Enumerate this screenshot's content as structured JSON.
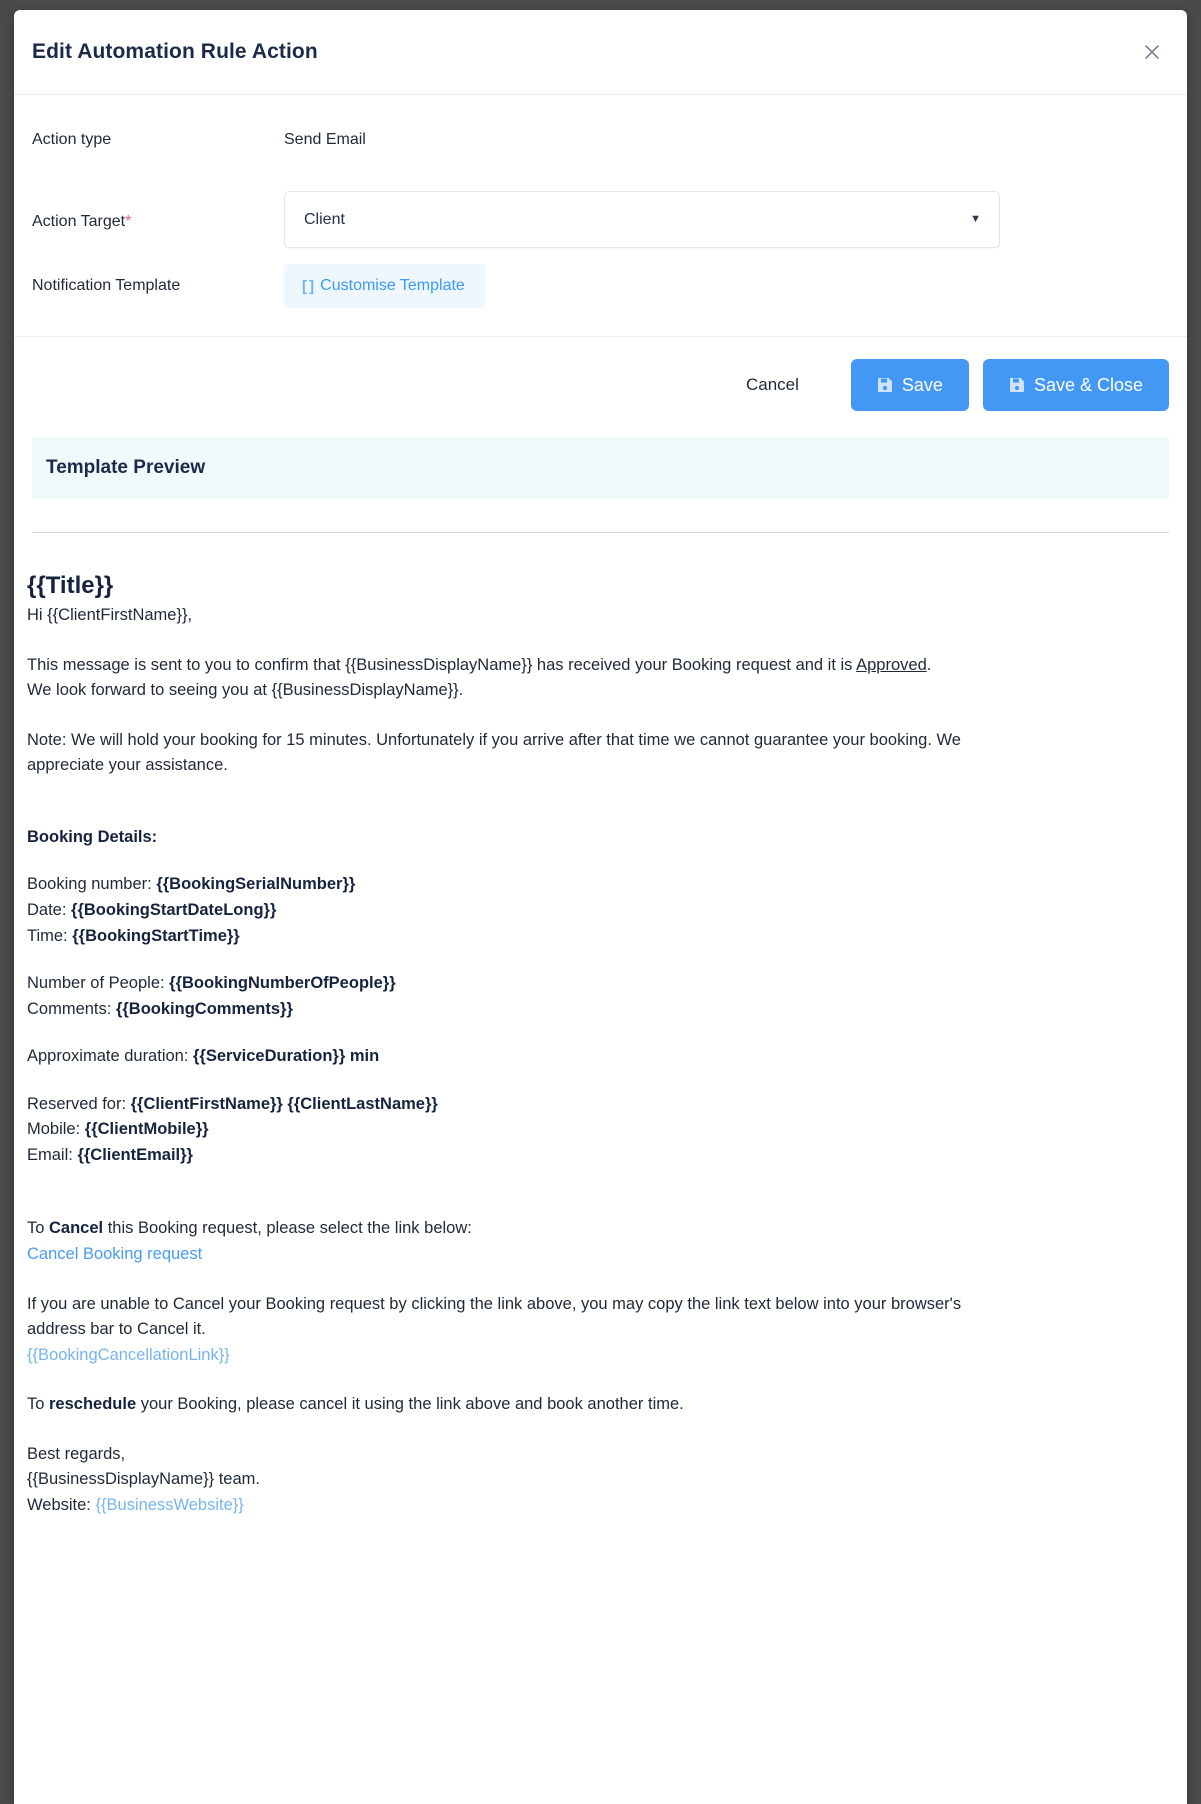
{
  "modal": {
    "title": "Edit Automation Rule Action",
    "close_icon": "close-icon"
  },
  "form": {
    "action_type": {
      "label": "Action type",
      "value": "Send Email"
    },
    "action_target": {
      "label": "Action Target",
      "required_marker": "*",
      "value": "Client",
      "caret_icon": "chevron-down-icon"
    },
    "notification_template": {
      "label": "Notification Template",
      "chip_icon": "[ ]",
      "chip_label": "Customise Template"
    }
  },
  "actions": {
    "cancel_label": "Cancel",
    "save_label": "Save",
    "save_close_label": "Save & Close",
    "primary_color": "#4398f5"
  },
  "preview": {
    "header": "Template Preview"
  },
  "email": {
    "title": "{{Title}}",
    "greeting": "Hi {{ClientFirstName}},",
    "intro_part1": "This message is sent to you to confirm that {{BusinessDisplayName}} has received your Booking request and it is ",
    "intro_status": "Approved",
    "intro_period": ".",
    "intro_line2": "We look forward to seeing you at {{BusinessDisplayName}}.",
    "note": "Note: We will hold your booking for 15 minutes. Unfortunately if you arrive after that time we cannot guarantee your booking. We appreciate your assistance.",
    "booking_details_heading": "Booking Details:",
    "details": [
      {
        "label": "Booking number: ",
        "value": "{{BookingSerialNumber}}"
      },
      {
        "label": "Date: ",
        "value": "{{BookingStartDateLong}}"
      },
      {
        "label": "Time: ",
        "value": "{{BookingStartTime}}"
      }
    ],
    "details2": [
      {
        "label": "Number of People: ",
        "value": "{{BookingNumberOfPeople}}"
      },
      {
        "label": "Comments: ",
        "value": "{{BookingComments}}"
      }
    ],
    "duration_label": "Approximate duration: ",
    "duration_value": "{{ServiceDuration}} min",
    "details3": [
      {
        "label": "Reserved for: ",
        "value": "{{ClientFirstName}} {{ClientLastName}}"
      },
      {
        "label": "Mobile: ",
        "value": "{{ClientMobile}}"
      },
      {
        "label": "Email: ",
        "value": "{{ClientEmail}}"
      }
    ],
    "cancel_intro_pre": "To ",
    "cancel_intro_bold": "Cancel",
    "cancel_intro_post": " this Booking request, please select the link below:",
    "cancel_link_text": "Cancel Booking request",
    "copy_instructions": "If you are unable to Cancel your Booking request by clicking the link above, you may copy the link text below into your browser's address bar to Cancel it.",
    "cancellation_link_token": "{{BookingCancellationLink}}",
    "reschedule_pre": "To ",
    "reschedule_bold": "reschedule",
    "reschedule_post": " your Booking, please cancel it using the link above and book another time.",
    "signoff": "Best regards,",
    "signoff_team": "{{BusinessDisplayName}} team.",
    "website_label": "Website: ",
    "website_value": "{{BusinessWebsite}}"
  }
}
